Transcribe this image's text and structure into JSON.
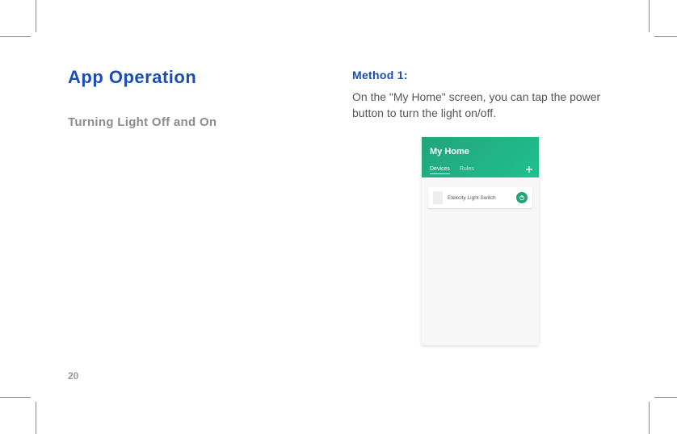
{
  "left": {
    "section_title": "App Operation",
    "subsection": "Turning Light Off and On"
  },
  "right": {
    "method_title": "Method 1:",
    "method_body": "On the \"My Home\" screen, you can tap the power button to turn the light on/off."
  },
  "page_number": "20",
  "phone": {
    "header_title": "My Home",
    "tabs": {
      "devices": "Devices",
      "rules": "Rules"
    },
    "device_name": "Etekcity Light Switch"
  }
}
